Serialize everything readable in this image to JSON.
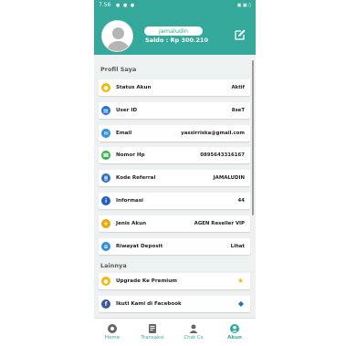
{
  "status_bar": {
    "time": "7.56",
    "signal": "● ● ●",
    "right": "▣ ▣ ▯"
  },
  "header": {
    "username": "jamaludin",
    "saldo_label": "Saldo : Rp 300.210"
  },
  "profil": {
    "title": "Profil Saya",
    "rows": [
      {
        "label": "Status Akun",
        "value": "Aktif",
        "icon": "status-icon",
        "color": "#f5b800"
      },
      {
        "label": "User ID",
        "value": "8seT",
        "icon": "id-card-icon",
        "color": "#1e73d8"
      },
      {
        "label": "Email",
        "value": "yassirriska@gmail.com",
        "icon": "email-icon",
        "color": "#2d8fe0"
      },
      {
        "label": "Nomor Hp",
        "value": "0895643316167",
        "icon": "phone-icon",
        "color": "#2fb24a"
      },
      {
        "label": "Kode Referral",
        "value": "JAMALUDIN",
        "icon": "referral-icon",
        "color": "#2c6fc2"
      },
      {
        "label": "Informasi",
        "value": "44",
        "icon": "info-icon",
        "color": "#1f5fc8"
      },
      {
        "label": "Jenis Akun",
        "value": "AGEN Reseller VIP",
        "icon": "account-type-icon",
        "color": "#f0a500"
      },
      {
        "label": "Riwayat Deposit",
        "value": "Lihat",
        "icon": "deposit-history-icon",
        "color": "#2d8fe0"
      }
    ]
  },
  "lainnya": {
    "title": "Lainnya",
    "rows": [
      {
        "label": "Upgrade Ke Premium",
        "icon": "upgrade-icon",
        "color": "#f5b800",
        "right_icon": "star-icon"
      },
      {
        "label": "Ikuti Kami di Facebook",
        "icon": "facebook-icon",
        "color": "#3b5998",
        "right_icon": "diamond-icon"
      }
    ]
  },
  "nav": {
    "items": [
      {
        "label": "Home",
        "icon": "home-icon"
      },
      {
        "label": "Transaksi",
        "icon": "transaction-icon"
      },
      {
        "label": "Chat Cs",
        "icon": "chat-icon"
      },
      {
        "label": "Akun",
        "icon": "account-icon"
      }
    ],
    "active_index": 3
  },
  "colors": {
    "primary": "#34a99b",
    "background": "#eef1f1"
  }
}
